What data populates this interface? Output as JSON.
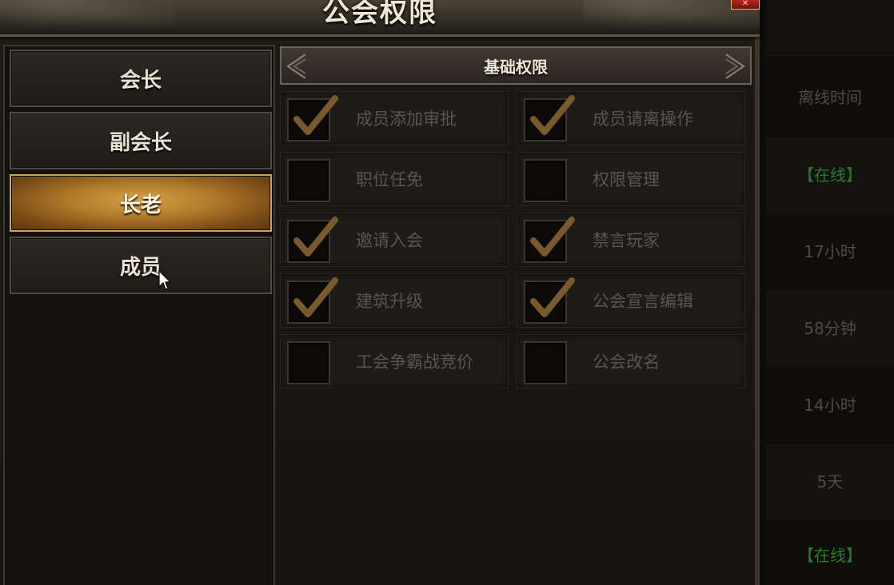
{
  "window": {
    "title": "公会权限",
    "close_icon": "close-icon"
  },
  "ranks": [
    {
      "label": "会长",
      "active": false
    },
    {
      "label": "副会长",
      "active": false
    },
    {
      "label": "长老",
      "active": true
    },
    {
      "label": "成员",
      "active": false
    }
  ],
  "section": {
    "title": "基础权限"
  },
  "permissions": [
    {
      "label": "成员添加审批",
      "checked": true
    },
    {
      "label": "成员请离操作",
      "checked": true
    },
    {
      "label": "职位任免",
      "checked": false
    },
    {
      "label": "权限管理",
      "checked": false
    },
    {
      "label": "邀请入会",
      "checked": true
    },
    {
      "label": "禁言玩家",
      "checked": true
    },
    {
      "label": "建筑升级",
      "checked": true
    },
    {
      "label": "公会宣言编辑",
      "checked": true
    },
    {
      "label": "工会争霸战竞价",
      "checked": false
    },
    {
      "label": "公会改名",
      "checked": false
    }
  ],
  "side_column": {
    "header": "离线时间",
    "values": [
      "【在线】",
      "17小时",
      "58分钟",
      "14小时",
      "5天",
      "【在线】"
    ]
  },
  "colors": {
    "accent_gold": "#b17a2a",
    "check_color": "#7a5a2c",
    "online_green": "#2d7a2d"
  }
}
